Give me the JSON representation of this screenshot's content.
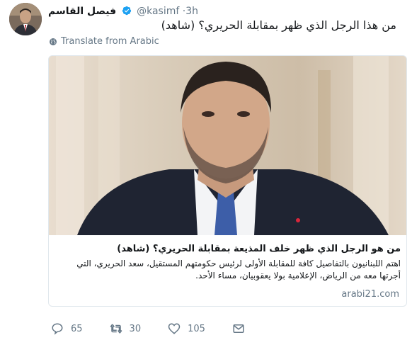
{
  "tweet": {
    "author_name": "فيصل القاسم",
    "handle": "@kasimf",
    "separator": "·",
    "time": "3h",
    "text": "من هذا الرجل الذي ظهر بمقابلة الحريري؟ (شاهد)",
    "translate_label": "Translate from Arabic"
  },
  "card": {
    "title": "من هو الرجل الذي ظهر خلف المذيعة بمقابلة الحريري؟ (شاهد)",
    "description": "اهتم اللبنانيون بالتفاصيل كافة للمقابلة الأولى لرئيس حكومتهم المستقيل، سعد الحريري، التي أجرتها معه من الرياض، الإعلامية بولا يعقوبيان، مساء الأحد.",
    "domain": "arabi21.com"
  },
  "actions": {
    "reply_count": "65",
    "retweet_count": "30",
    "like_count": "105"
  },
  "icons": {
    "verified": "verified-badge-icon",
    "globe": "globe-icon",
    "reply": "reply-icon",
    "retweet": "retweet-icon",
    "like": "heart-icon",
    "dm": "envelope-icon"
  },
  "colors": {
    "verified": "#1da1f2",
    "muted": "#657786",
    "text": "#14171a",
    "border": "#e1e8ed"
  }
}
